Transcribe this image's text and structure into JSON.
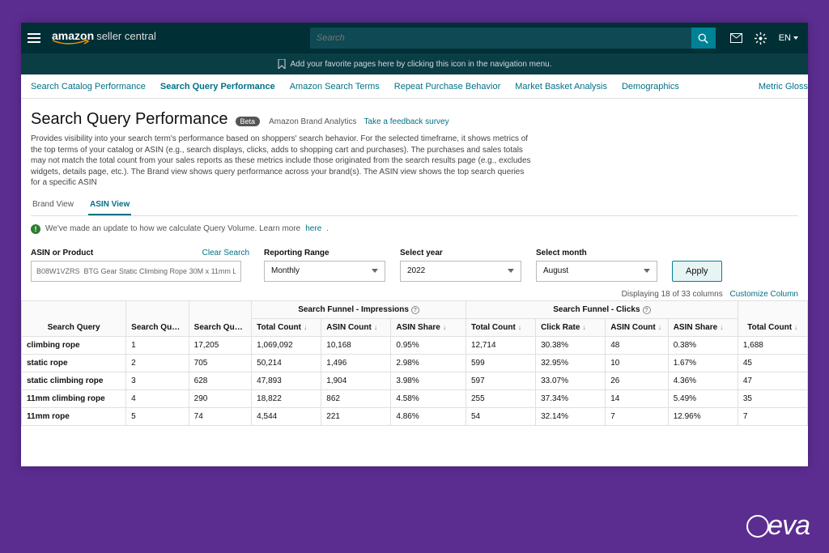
{
  "header": {
    "brand_main": "amazon",
    "brand_sub": "seller central",
    "search_placeholder": "Search",
    "lang": "EN"
  },
  "favbar": {
    "text": "Add your favorite pages here by clicking this icon in the navigation menu."
  },
  "tabs": {
    "items": [
      "Search Catalog Performance",
      "Search Query Performance",
      "Amazon Search Terms",
      "Repeat Purchase Behavior",
      "Market Basket Analysis",
      "Demographics"
    ],
    "right": "Metric Gloss"
  },
  "page": {
    "title": "Search Query Performance",
    "beta": "Beta",
    "source": "Amazon Brand Analytics",
    "survey": "Take a feedback survey",
    "description": "Provides visibility into your search term's performance based on shoppers' search behavior. For the selected timeframe, it shows metrics of the top terms of your catalog or ASIN (e.g., search displays, clicks, adds to shopping cart and purchases). The purchases and sales totals may not match the total count from your sales reports as these metrics include those originated from the search results page (e.g., excludes widgets, details page, etc.). The Brand view shows query performance across your brand(s). The ASIN view shows the top search queries for a specific ASIN"
  },
  "view_tabs": {
    "brand": "Brand View",
    "asin": "ASIN View"
  },
  "notice": {
    "text": "We've made an update to how we calculate Query Volume. Learn more",
    "link": "here"
  },
  "filters": {
    "asin_label": "ASIN or Product",
    "asin_value": "B08W1VZRS  BTG Gear Static Climbing Rope 30M x 11mm L…",
    "clear": "Clear Search",
    "range_label": "Reporting Range",
    "range_value": "Monthly",
    "year_label": "Select year",
    "year_value": "2022",
    "month_label": "Select month",
    "month_value": "August",
    "apply": "Apply"
  },
  "cols_meta": {
    "text": "Displaying 18 of 33 columns",
    "link": "Customize Column"
  },
  "table": {
    "group_impressions": "Search Funnel - Impressions",
    "group_clicks": "Search Funnel - Clicks",
    "cols": {
      "query": "Search Query",
      "score": "Search Query Score",
      "volume": "Search Query Volume",
      "total1": "Total Count",
      "asin_count1": "ASIN Count",
      "asin_share1": "ASIN Share",
      "total2": "Total Count",
      "click_rate": "Click Rate",
      "asin_count2": "ASIN Count",
      "asin_share2": "ASIN Share",
      "total3": "Total Count"
    },
    "rows": [
      {
        "q": "climbing rope",
        "score": "1",
        "vol": "17,205",
        "t1": "1,069,092",
        "ac1": "10,168",
        "as1": "0.95%",
        "t2": "12,714",
        "cr": "30.38%",
        "ac2": "48",
        "as2": "0.38%",
        "t3": "1,688"
      },
      {
        "q": "static rope",
        "score": "2",
        "vol": "705",
        "t1": "50,214",
        "ac1": "1,496",
        "as1": "2.98%",
        "t2": "599",
        "cr": "32.95%",
        "ac2": "10",
        "as2": "1.67%",
        "t3": "45"
      },
      {
        "q": "static climbing rope",
        "score": "3",
        "vol": "628",
        "t1": "47,893",
        "ac1": "1,904",
        "as1": "3.98%",
        "t2": "597",
        "cr": "33.07%",
        "ac2": "26",
        "as2": "4.36%",
        "t3": "47"
      },
      {
        "q": "11mm climbing rope",
        "score": "4",
        "vol": "290",
        "t1": "18,822",
        "ac1": "862",
        "as1": "4.58%",
        "t2": "255",
        "cr": "37.34%",
        "ac2": "14",
        "as2": "5.49%",
        "t3": "35"
      },
      {
        "q": "11mm rope",
        "score": "5",
        "vol": "74",
        "t1": "4,544",
        "ac1": "221",
        "as1": "4.86%",
        "t2": "54",
        "cr": "32.14%",
        "ac2": "7",
        "as2": "12.96%",
        "t3": "7"
      }
    ]
  },
  "logo": "eva"
}
